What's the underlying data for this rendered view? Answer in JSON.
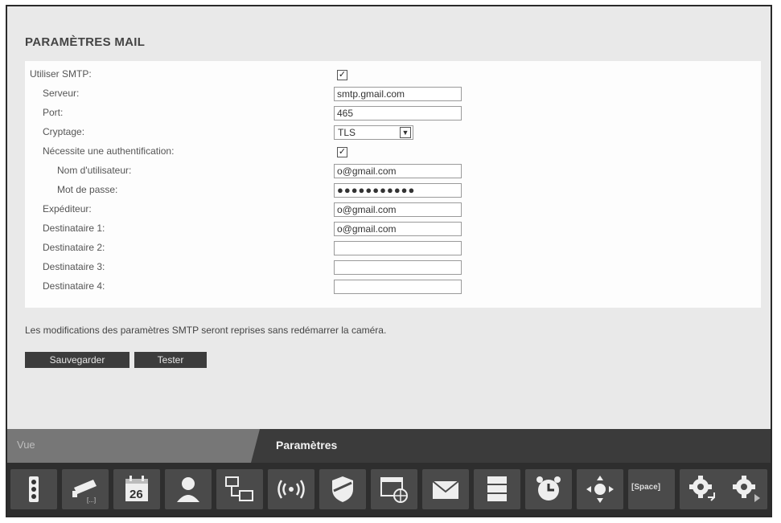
{
  "header": {
    "title": "PARAMÈTRES MAIL"
  },
  "form": {
    "smtp_label": "Utiliser SMTP:",
    "smtp_checked": "✓",
    "server_label": "Serveur:",
    "server_value": "smtp.gmail.com",
    "port_label": "Port:",
    "port_value": "465",
    "crypt_label": "Cryptage:",
    "crypt_value": "TLS",
    "auth_label": "Nécessite une authentification:",
    "auth_checked": "✓",
    "user_label": "Nom d'utilisateur:",
    "user_value": "o@gmail.com",
    "pass_label": "Mot de passe:",
    "pass_value": "●●●●●●●●●●●",
    "sender_label": "Expéditeur:",
    "sender_value": "o@gmail.com",
    "dest1_label": "Destinataire 1:",
    "dest1_value": "o@gmail.com",
    "dest2_label": "Destinataire 2:",
    "dest2_value": "",
    "dest3_label": "Destinataire 3:",
    "dest3_value": "",
    "dest4_label": "Destinataire 4:",
    "dest4_value": ""
  },
  "note": "Les modifications des paramètres SMTP seront reprises sans redémarrer la caméra.",
  "buttons": {
    "save": "Sauvegarder",
    "test": "Tester"
  },
  "tabs": {
    "vue": "Vue",
    "parametres": "Paramètres"
  },
  "toolbar": {
    "calendar_day": "26",
    "space_label": "[Space]",
    "icons": [
      "status-icon",
      "camera-icon",
      "calendar-icon",
      "user-icon",
      "network-icon",
      "wireless-icon",
      "security-shield-icon",
      "web-settings-icon",
      "mail-icon",
      "storage-icon",
      "alarm-clock-icon",
      "ptz-control-icon",
      "space-icon",
      "system-settings-icon",
      "advanced-settings-icon"
    ]
  }
}
